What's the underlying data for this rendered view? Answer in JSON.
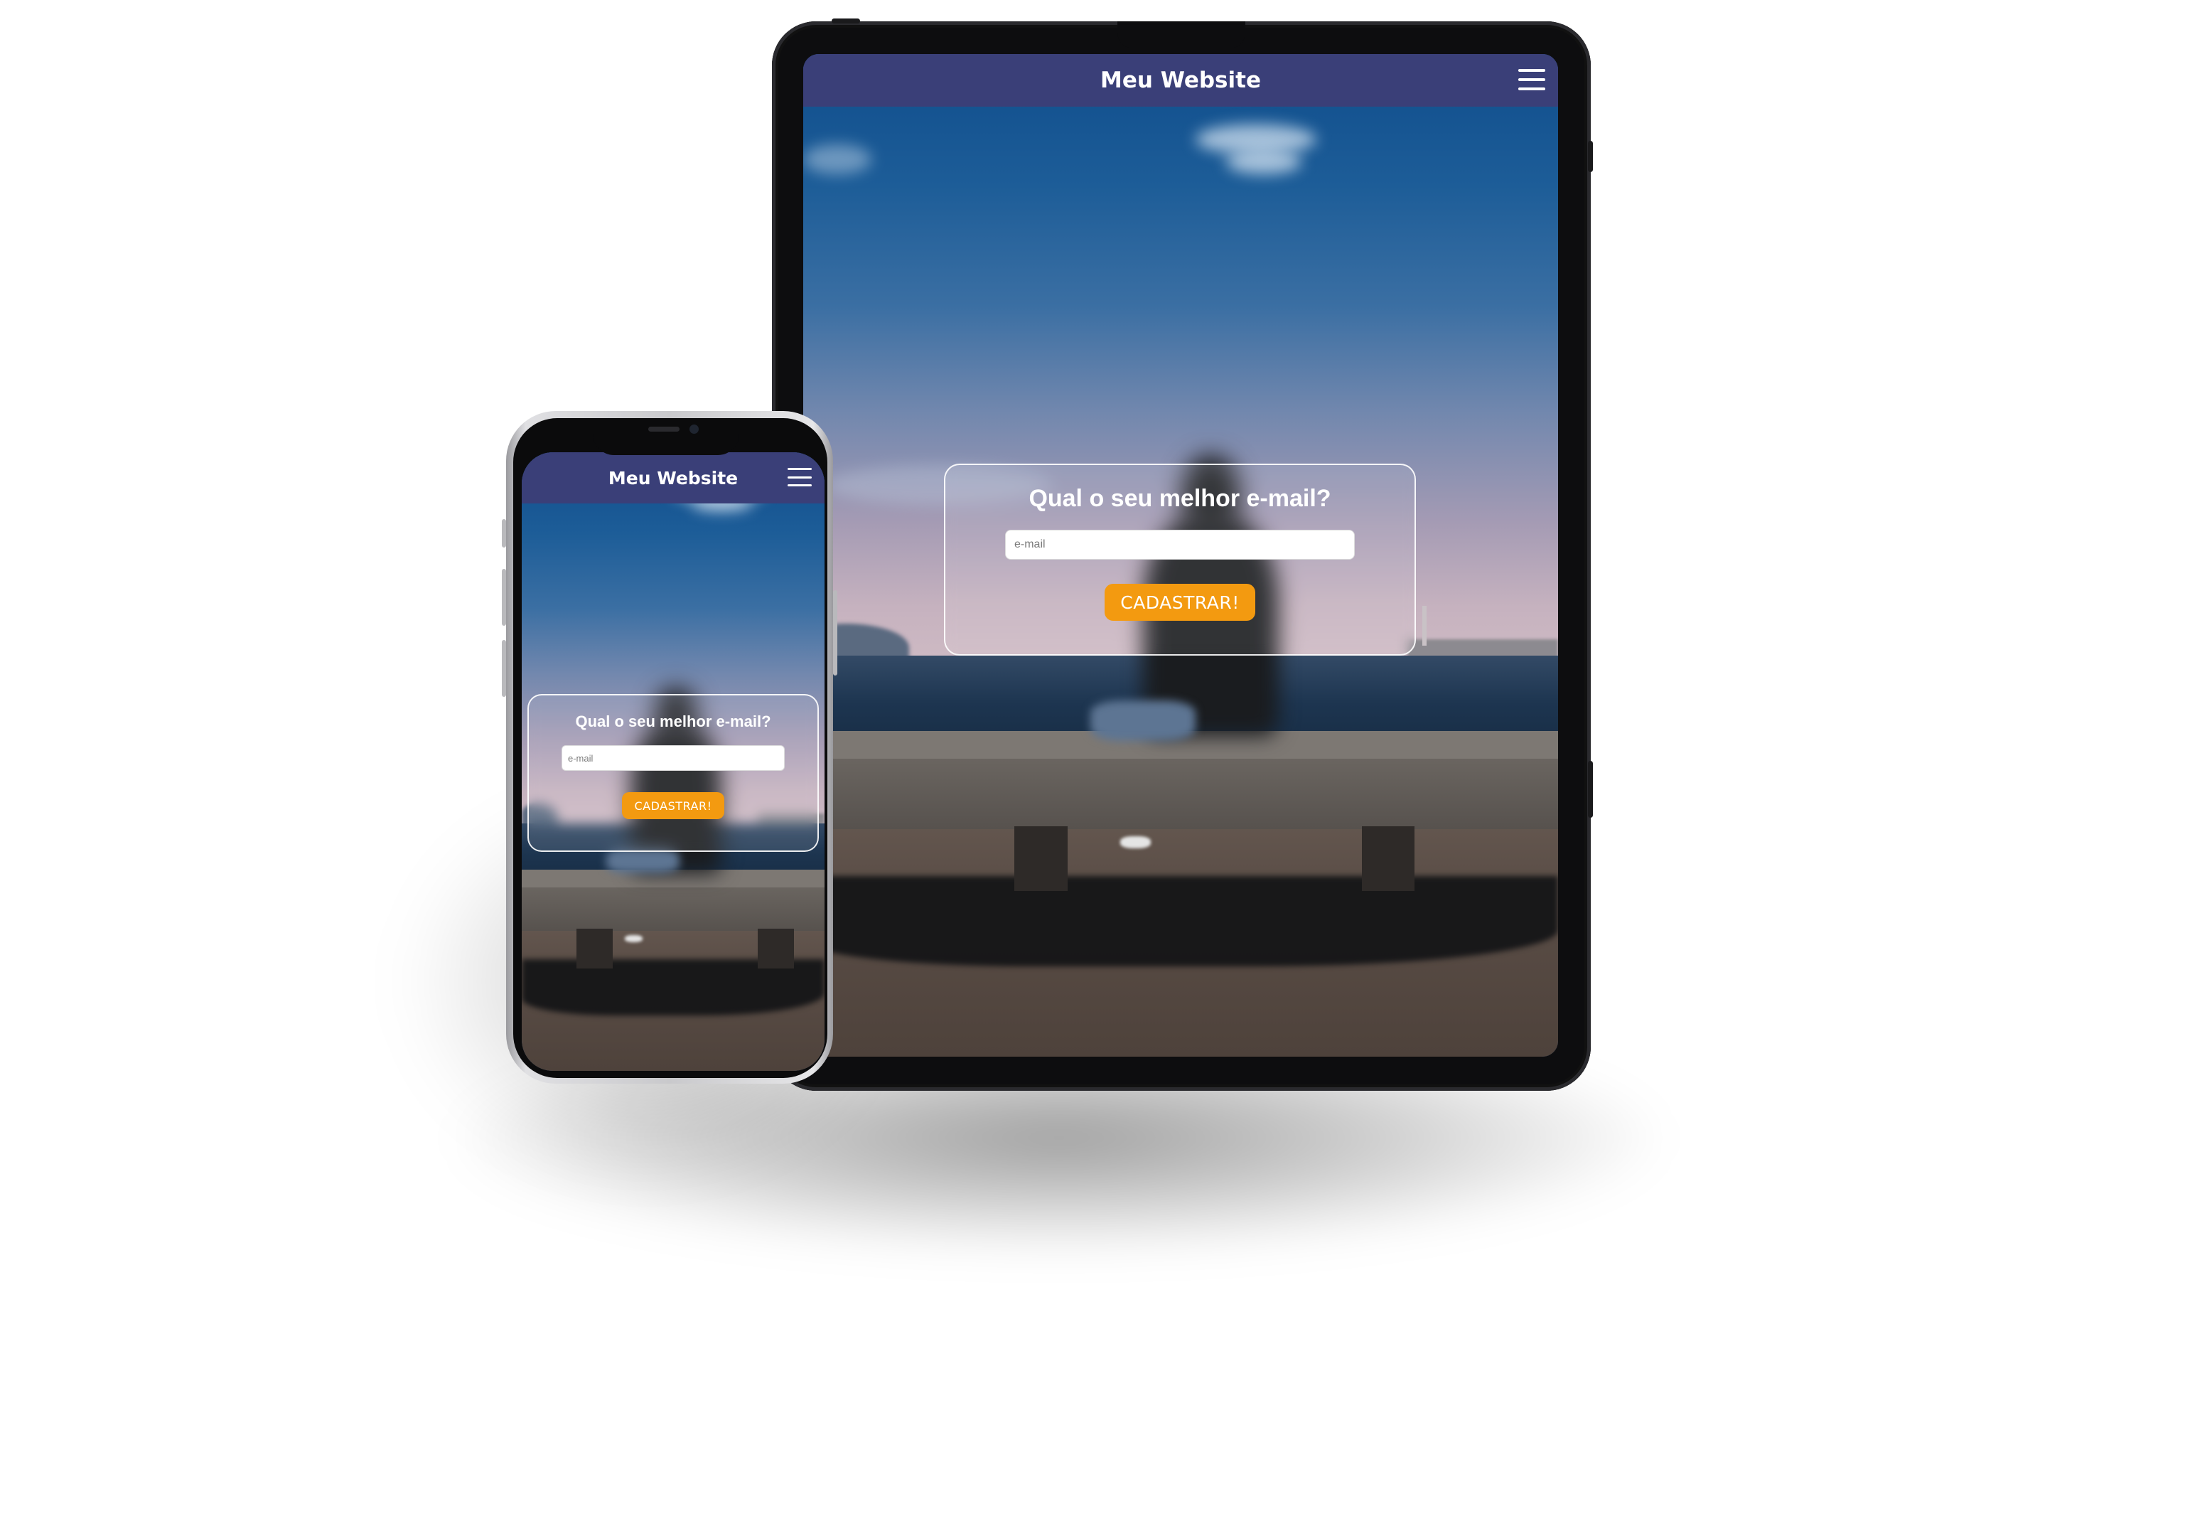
{
  "tablet": {
    "site_title": "Meu Website",
    "menu_icon": "hamburger-menu-icon",
    "signup_card": {
      "heading": "Qual o seu melhor e-mail?",
      "email_placeholder": "e-mail",
      "submit_label": "CADASTRAR!"
    }
  },
  "phone": {
    "site_title": "Meu Website",
    "menu_icon": "hamburger-menu-icon",
    "signup_card": {
      "heading": "Qual o seu melhor e-mail?",
      "email_placeholder": "e-mail",
      "submit_label": "CADASTRAR!"
    }
  },
  "colors": {
    "navbar": "#3a3f78",
    "cta_button": "#f39a10",
    "text_on_dark": "#ffffff"
  }
}
